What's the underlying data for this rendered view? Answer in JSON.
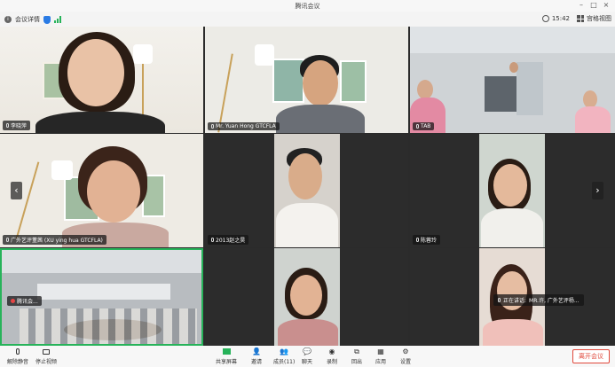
{
  "window": {
    "title": "腾讯会议"
  },
  "infobar": {
    "meeting_info": "会议详情",
    "time": "15:42",
    "view_label": "宫格视图"
  },
  "participants": [
    {
      "name": "李晓萍"
    },
    {
      "name": "Mr. Yuan Hong GTCFLA"
    },
    {
      "name": "TAB"
    },
    {
      "name": "广外艺评董茜 (XU ying hua GTCFLA)"
    },
    {
      "name": "2013赵之昊"
    },
    {
      "name": "陈蓉玲"
    },
    {
      "name": "腾讯会..."
    }
  ],
  "speaking": {
    "label": "正在讲话:",
    "name": "MR.许, 广外艺评杨..."
  },
  "toolbar": {
    "unmute": "解除静音",
    "stop_video": "停止视频",
    "share": "共享屏幕",
    "invite": "邀请",
    "members": "成员(11)",
    "chat": "聊天",
    "record": "录制",
    "rooms": "回出",
    "apps": "应用",
    "settings": "设置",
    "leave": "离开会议"
  },
  "colors": {
    "accent": "#27b35a",
    "leave": "#e0483b",
    "mic_off": "#e54545"
  },
  "icons": [
    "info-icon",
    "shield-icon",
    "signal-icon",
    "clock-icon",
    "grid-view-icon",
    "mic-icon",
    "camera-icon",
    "share-screen-icon",
    "invite-icon",
    "members-icon",
    "chat-icon",
    "record-icon",
    "rooms-icon",
    "apps-icon",
    "settings-icon"
  ]
}
